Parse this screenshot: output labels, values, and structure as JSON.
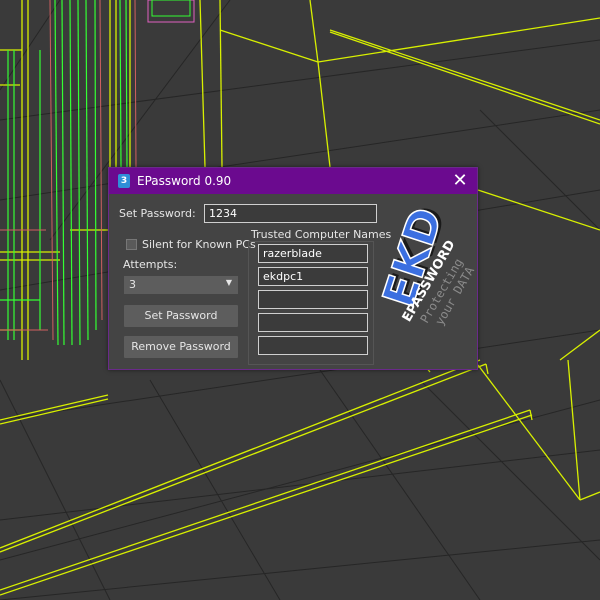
{
  "dialog": {
    "title": "EPassword 0.90",
    "app_icon_glyph": "3",
    "close_glyph": "✕",
    "set_password_label": "Set Password:",
    "password_value": "1234",
    "silent_label": "Silent for Known PCs",
    "silent_checked": false,
    "attempts_label": "Attempts:",
    "attempts_value": "3",
    "set_password_button": "Set Password",
    "remove_password_button": "Remove Password",
    "trusted_label": "Trusted Computer Names",
    "trusted_names": [
      "razerblade",
      "ekdpc1",
      "",
      "",
      ""
    ]
  },
  "logo": {
    "brand": "EKD",
    "product": "EPASSWORD",
    "tagline_1": "Protecting",
    "tagline_2": "your DATA"
  },
  "colors": {
    "titlebar": "#6b0a8f",
    "dialog_bg": "#444444",
    "viewport_bg": "#3a3a3a",
    "wire_yellow": "#d8f000",
    "wire_green": "#33ff33",
    "wire_red": "#d06060",
    "logo_blue": "#3b6fe0"
  }
}
